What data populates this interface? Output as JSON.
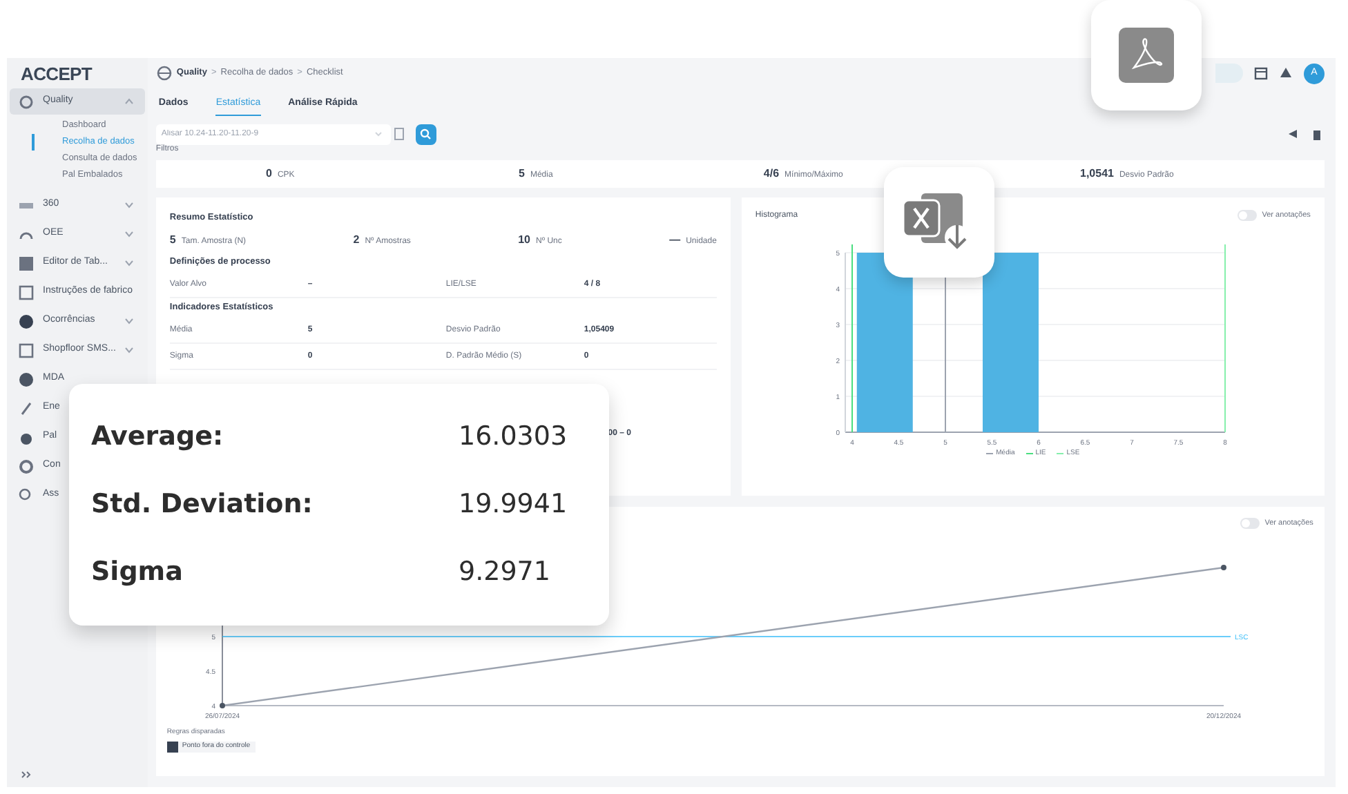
{
  "sidebar": {
    "logo": "ACCEPT",
    "items": [
      {
        "label": "Quality",
        "kind": "group",
        "expanded": true,
        "selected": true,
        "children": [
          {
            "label": "Dashboard",
            "selected": false
          },
          {
            "label": "Recolha de dados",
            "selected": true
          },
          {
            "label": "Consulta de dados",
            "selected": false
          },
          {
            "label": "Pal Embalados",
            "selected": false
          }
        ]
      },
      {
        "label": "360",
        "kind": "group",
        "expanded": false,
        "selected": false
      },
      {
        "label": "OEE",
        "kind": "group",
        "expanded": false,
        "selected": false
      },
      {
        "label": "Editor de Tab...",
        "kind": "group",
        "expanded": false,
        "selected": false
      },
      {
        "label": "Instruções de fabrico",
        "kind": "link",
        "selected": false
      },
      {
        "label": "Ocorrências",
        "kind": "group",
        "expanded": false,
        "selected": false
      },
      {
        "label": "Shopfloor SMS...",
        "kind": "group",
        "expanded": false,
        "selected": false
      },
      {
        "label": "MDA",
        "kind": "link",
        "selected": false
      },
      {
        "label": "Ene",
        "kind": "link",
        "selected": false
      },
      {
        "label": "Pal",
        "kind": "link",
        "selected": false
      },
      {
        "label": "Con",
        "kind": "link",
        "selected": false
      },
      {
        "label": "Ass",
        "kind": "link",
        "selected": false
      }
    ]
  },
  "header": {
    "breadcrumb": [
      "Quality",
      ">",
      "Recolha de dados",
      ">",
      "Checklist"
    ],
    "avatar": "A"
  },
  "tabs": [
    {
      "label": "Dados",
      "selected": false
    },
    {
      "label": "Estatística",
      "selected": true
    },
    {
      "label": "Análise Rápida",
      "selected": false
    }
  ],
  "search": {
    "placeholder": "Alisar 10.24-11.20-11.20-9"
  },
  "filters_label": "Filtros",
  "stats_bar": [
    {
      "value": "0",
      "label": "CPK"
    },
    {
      "value": "5",
      "label": "Média"
    },
    {
      "value": "4/6",
      "label": "Mínimo/Máximo"
    },
    {
      "value": "1,0541",
      "label": "Desvio Padrão"
    }
  ],
  "summary": {
    "title": "Resumo Estatístico",
    "counts": [
      {
        "value": "5",
        "label": "Tam. Amostra (N)"
      },
      {
        "value": "2",
        "label": "Nº Amostras"
      },
      {
        "value": "10",
        "label": "Nº Unc"
      },
      {
        "value": "—",
        "label": "Unidade"
      }
    ],
    "process_title": "Definições de processo",
    "process_rows": [
      [
        "Valor Alvo",
        "–",
        "LIE/LSE",
        "4 / 8"
      ]
    ],
    "indicators_title": "Indicadores Estatísticos",
    "indicator_rows": [
      [
        "Média",
        "5",
        "Desvio Padrão",
        "1,05409"
      ],
      [
        "Sigma",
        "0",
        "D. Padrão Médio (S)",
        "0"
      ]
    ],
    "partial_cell": "00 – 0"
  },
  "histogram": {
    "toggle": {
      "label": "Ver anotações",
      "on": false
    },
    "chart_data": {
      "type": "bar",
      "title": "Histograma",
      "x": [
        4.35,
        5.7
      ],
      "values": [
        5,
        5
      ],
      "xlim": [
        4,
        8
      ],
      "ylim": [
        0,
        5
      ],
      "xticks": [
        4,
        4.5,
        5,
        5.5,
        6,
        6.5,
        7,
        7.5,
        8
      ],
      "yticks": [
        0,
        1,
        2,
        3,
        4,
        5
      ],
      "grid": true,
      "ref_lines": [
        {
          "axis": "x",
          "value": 5,
          "label": "Média",
          "color": "#9ca3af"
        },
        {
          "axis": "x",
          "value": 4,
          "label": "LIE",
          "color": "#4ade80"
        },
        {
          "axis": "x",
          "value": 8,
          "label": "LSE",
          "color": "#86efac"
        }
      ]
    }
  },
  "control_chart": {
    "toggle": {
      "label": "Ver anotações",
      "on": false
    },
    "chart_data": {
      "type": "line",
      "x": [
        "26/07/2024",
        "20/12/2024"
      ],
      "series": [
        {
          "color": "#9ca3af",
          "marker": "circle",
          "values": [
            4,
            6
          ]
        }
      ],
      "ylim": [
        4,
        6
      ],
      "yticks": [
        4,
        4.5,
        5
      ],
      "ref_lines": [
        {
          "axis": "y",
          "value": 5,
          "label": "LSC",
          "color": "#38bdf8"
        }
      ]
    },
    "rules_title": "Regras disparadas",
    "rules": [
      "Ponto fora do controle"
    ]
  },
  "popup": [
    {
      "label": "Average:",
      "value": "16.0303"
    },
    {
      "label": "Std. Deviation:",
      "value": "19.9941"
    },
    {
      "label": "Sigma",
      "value": "9.2971"
    }
  ]
}
